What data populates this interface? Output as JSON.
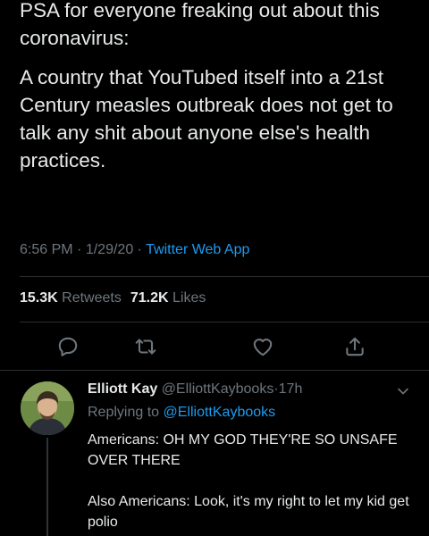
{
  "tweet": {
    "paragraph1": "PSA for everyone freaking out about this coronavirus:",
    "paragraph2": "A country that YouTubed itself into a 21st Century measles outbreak does not get to talk any shit about anyone else's health practices.",
    "time": "6:56 PM",
    "date": "1/29/20",
    "source": "Twitter Web App",
    "dot": "·"
  },
  "stats": {
    "retweets_count": "15.3K",
    "retweets_label": "Retweets",
    "likes_count": "71.2K",
    "likes_label": "Likes"
  },
  "actions": {
    "icons": [
      "reply-icon",
      "retweet-icon",
      "like-icon",
      "share-icon"
    ]
  },
  "reply": {
    "name": "Elliott Kay",
    "handle": "@ElliottKaybooks",
    "dot": "·",
    "age": "17h",
    "replying_prefix": "Replying to",
    "replying_to": "@ElliottKaybooks",
    "line1": "Americans: OH MY GOD THEY'RE SO UNSAFE OVER THERE",
    "line2": "Also Americans: Look, it's my right to let my kid get polio"
  },
  "colors": {
    "background": "#000000",
    "text": "#e7e9ea",
    "muted": "#6e767d",
    "accent": "#1d9bf0"
  }
}
